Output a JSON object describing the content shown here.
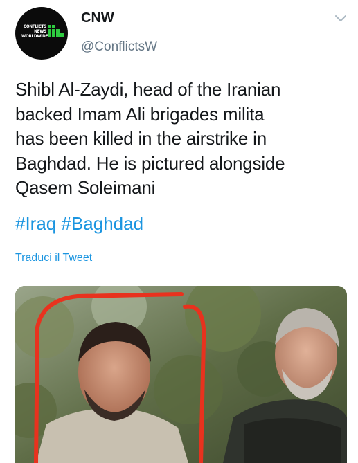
{
  "author": {
    "display_name": "CNW",
    "handle": "@ConflictsW",
    "avatar_logo_lines": [
      "CONFLICTS",
      "NEWS",
      "WORLDWIDE"
    ]
  },
  "tweet": {
    "text_lines": [
      "Shibl Al-Zaydi, head of the Iranian",
      "backed Imam Ali brigades milita",
      "has been killed in the airstrike in",
      "Baghdad. He is pictured alongside",
      "Qasem Soleimani"
    ],
    "hashtags": [
      "#Iraq",
      "#Baghdad"
    ],
    "translate_label": "Traduci il Tweet"
  },
  "icons": {
    "menu": "chevron-down-icon"
  },
  "colors": {
    "link": "#1b95e0",
    "secondary_text": "#657786",
    "highlight_mark": "#e8321e",
    "logo_green": "#2ecc40"
  }
}
